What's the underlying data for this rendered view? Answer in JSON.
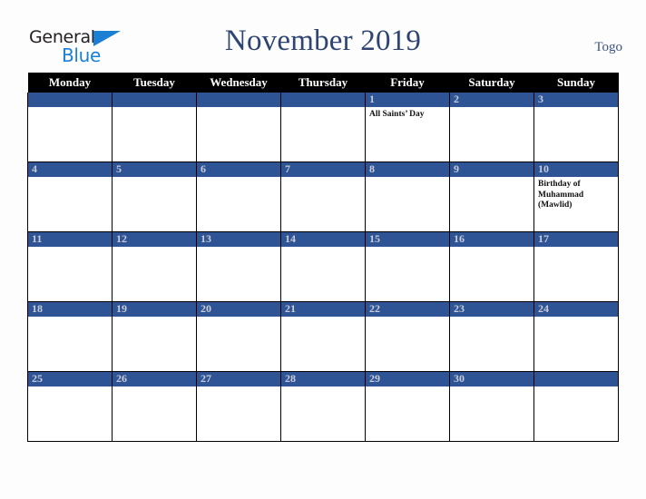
{
  "brand": {
    "word_one": "General",
    "word_two": "Blue",
    "triangle_icon": "triangle-icon",
    "color_dark": "#231f20",
    "color_blue": "#1b7fd4"
  },
  "header": {
    "title": "November 2019",
    "country": "Togo",
    "title_color": "#2e4573"
  },
  "calendar": {
    "weekday_headers": [
      "Monday",
      "Tuesday",
      "Wednesday",
      "Thursday",
      "Friday",
      "Saturday",
      "Sunday"
    ],
    "header_bg": "#000000",
    "daynum_bg": "#2e5496",
    "daynum_color": "#c8ccd6",
    "weeks": [
      [
        {
          "day": "",
          "event": ""
        },
        {
          "day": "",
          "event": ""
        },
        {
          "day": "",
          "event": ""
        },
        {
          "day": "",
          "event": ""
        },
        {
          "day": "1",
          "event": "All Saints’ Day"
        },
        {
          "day": "2",
          "event": ""
        },
        {
          "day": "3",
          "event": ""
        }
      ],
      [
        {
          "day": "4",
          "event": ""
        },
        {
          "day": "5",
          "event": ""
        },
        {
          "day": "6",
          "event": ""
        },
        {
          "day": "7",
          "event": ""
        },
        {
          "day": "8",
          "event": ""
        },
        {
          "day": "9",
          "event": ""
        },
        {
          "day": "10",
          "event": "Birthday of Muhammad (Mawlid)"
        }
      ],
      [
        {
          "day": "11",
          "event": ""
        },
        {
          "day": "12",
          "event": ""
        },
        {
          "day": "13",
          "event": ""
        },
        {
          "day": "14",
          "event": ""
        },
        {
          "day": "15",
          "event": ""
        },
        {
          "day": "16",
          "event": ""
        },
        {
          "day": "17",
          "event": ""
        }
      ],
      [
        {
          "day": "18",
          "event": ""
        },
        {
          "day": "19",
          "event": ""
        },
        {
          "day": "20",
          "event": ""
        },
        {
          "day": "21",
          "event": ""
        },
        {
          "day": "22",
          "event": ""
        },
        {
          "day": "23",
          "event": ""
        },
        {
          "day": "24",
          "event": ""
        }
      ],
      [
        {
          "day": "25",
          "event": ""
        },
        {
          "day": "26",
          "event": ""
        },
        {
          "day": "27",
          "event": ""
        },
        {
          "day": "28",
          "event": ""
        },
        {
          "day": "29",
          "event": ""
        },
        {
          "day": "30",
          "event": ""
        },
        {
          "day": "",
          "event": ""
        }
      ]
    ]
  }
}
